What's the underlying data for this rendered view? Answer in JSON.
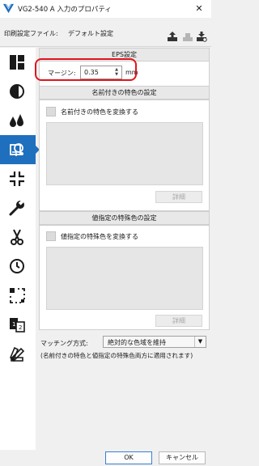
{
  "window": {
    "title": "VG2-540 A 入力のプロパティ",
    "close_glyph": "✕"
  },
  "print_setting": {
    "label": "印刷設定ファイル:",
    "value": "デフォルト設定"
  },
  "sidebar": {
    "active_index": 3,
    "active_color": "#1f6fbf",
    "items": [
      {
        "icon": "layout-icon"
      },
      {
        "icon": "half-circle-icon"
      },
      {
        "icon": "ink-drops-icon"
      },
      {
        "icon": "color-management-icon"
      },
      {
        "icon": "shrink-arrows-icon"
      },
      {
        "icon": "wrench-icon"
      },
      {
        "icon": "scissors-icon"
      },
      {
        "icon": "clock-icon"
      },
      {
        "icon": "crop-marks-icon"
      },
      {
        "icon": "page-order-icon"
      },
      {
        "icon": "color-swatch-fan-icon"
      }
    ]
  },
  "eps": {
    "heading": "EPS設定",
    "margin_label": "マージン:",
    "margin_value": "0.35",
    "unit": "mm"
  },
  "named_colors": {
    "heading": "名前付きの特色の設定",
    "checkbox_label": "名前付きの特色を変換する",
    "detail_button": "詳細"
  },
  "value_spot_colors": {
    "heading": "値指定の特殊色の設定",
    "checkbox_label": "値指定の特殊色を変換する",
    "detail_button": "詳細"
  },
  "matching": {
    "label": "マッチング方式:",
    "selected": "絶対的な色域を維持",
    "note": "(名前付きの特色と値指定の特殊色両方に適用されます)"
  },
  "footer": {
    "ok": "OK",
    "cancel": "キャンセル"
  },
  "colors": {
    "accent": "#1f6fbf",
    "highlight": "#e0141b"
  }
}
